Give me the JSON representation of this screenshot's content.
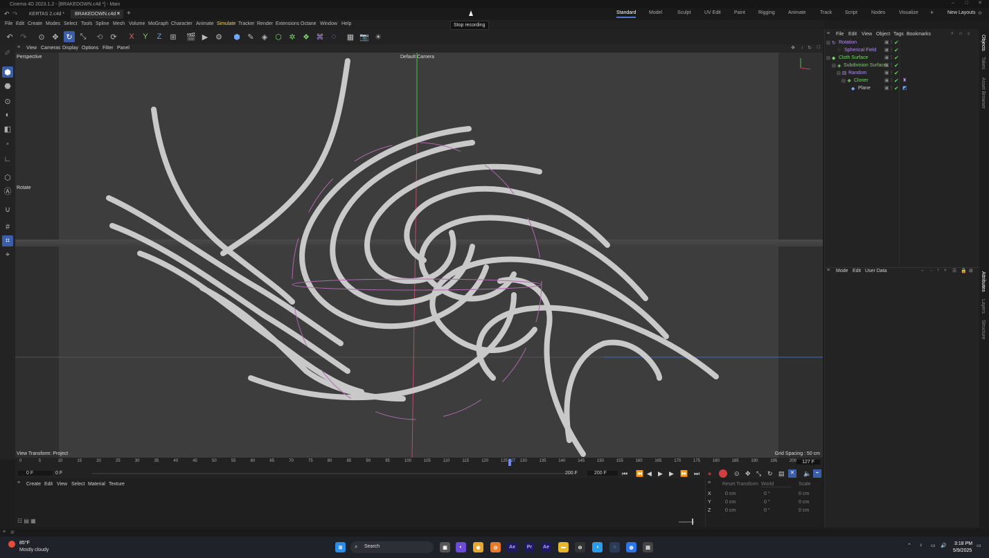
{
  "app": {
    "title": "Cinema 4D 2023.1.2 - [BRAKEDOWN.c4d *] - Main"
  },
  "file_tabs": [
    {
      "label": "KERTAS 2.c4d *"
    },
    {
      "label": "BRAKEDOWN.c4d *"
    }
  ],
  "layouts": [
    "Standard",
    "Model",
    "Sculpt",
    "UV Edit",
    "Paint",
    "Rigging",
    "Animate",
    "Track",
    "Script",
    "Nodes",
    "Visualize"
  ],
  "new_layouts_label": "New Layouts",
  "tooltip": "Stop recording",
  "menu": [
    "File",
    "Edit",
    "Create",
    "Modes",
    "Select",
    "Tools",
    "Spline",
    "Mesh",
    "Volume",
    "MoGraph",
    "Character",
    "Animate",
    "Simulate",
    "Tracker",
    "Render",
    "Extensions",
    "Octane",
    "Window",
    "Help"
  ],
  "viewport": {
    "menu": [
      "View",
      "Cameras",
      "Display",
      "Options",
      "Filter",
      "Panel"
    ],
    "projection": "Perspective",
    "camera": "Default Camera",
    "tool_label": "Rotate",
    "view_transform": "View Transform: Project",
    "grid_spacing": "Grid Spacing : 50 cm"
  },
  "timeline": {
    "ticks": [
      "0",
      "5",
      "10",
      "15",
      "20",
      "25",
      "30",
      "35",
      "40",
      "45",
      "50",
      "55",
      "60",
      "65",
      "70",
      "75",
      "80",
      "85",
      "90",
      "95",
      "100",
      "105",
      "110",
      "115",
      "120",
      "125",
      "127",
      "130",
      "135",
      "140",
      "145",
      "150",
      "155",
      "160",
      "165",
      "170",
      "175",
      "180",
      "185",
      "190",
      "195",
      "200"
    ],
    "current_frame": "127 F",
    "start_frame": "0 F",
    "start_frame2": "0 F",
    "end_frame": "200 F",
    "end_frame2": "200 F"
  },
  "material_menu": [
    "Create",
    "Edit",
    "View",
    "Select",
    "Material",
    "Texture"
  ],
  "coords": {
    "header": [
      "Reset Transform",
      "World",
      "Scale"
    ],
    "rows": [
      {
        "axis": "X",
        "pos": "0 cm",
        "rot": "0 °",
        "scale": "0 cm"
      },
      {
        "axis": "Y",
        "pos": "0 cm",
        "rot": "0 °",
        "scale": "0 cm"
      },
      {
        "axis": "Z",
        "pos": "0 cm",
        "rot": "0 °",
        "scale": "0 cm"
      }
    ]
  },
  "objects_menu": [
    "File",
    "Edit",
    "View",
    "Object",
    "Tags",
    "Bookmarks"
  ],
  "objects": [
    {
      "name": "Rotation",
      "indent": 0
    },
    {
      "name": "Spherical Field",
      "indent": 1
    },
    {
      "name": "Cloth Surface",
      "indent": 0
    },
    {
      "name": "Subdivision Surface",
      "indent": 1
    },
    {
      "name": "Random",
      "indent": 2
    },
    {
      "name": "Cloner",
      "indent": 3
    },
    {
      "name": "Plane",
      "indent": 4
    }
  ],
  "attributes_menu": [
    "Mode",
    "Edit",
    "User Data"
  ],
  "right_tabs": [
    "Objects",
    "Takes",
    "Asset Browser",
    "Attributes",
    "Layers",
    "Structure"
  ],
  "taskbar": {
    "weather_temp": "85°F",
    "weather_text": "Mostly cloudy",
    "search_label": "Search",
    "time": "3:18 PM",
    "date": "5/9/2025"
  },
  "colors": {
    "accent": "#3a5ea8",
    "check": "#5fd35f",
    "viewport_bg": "#3d3d3d"
  }
}
